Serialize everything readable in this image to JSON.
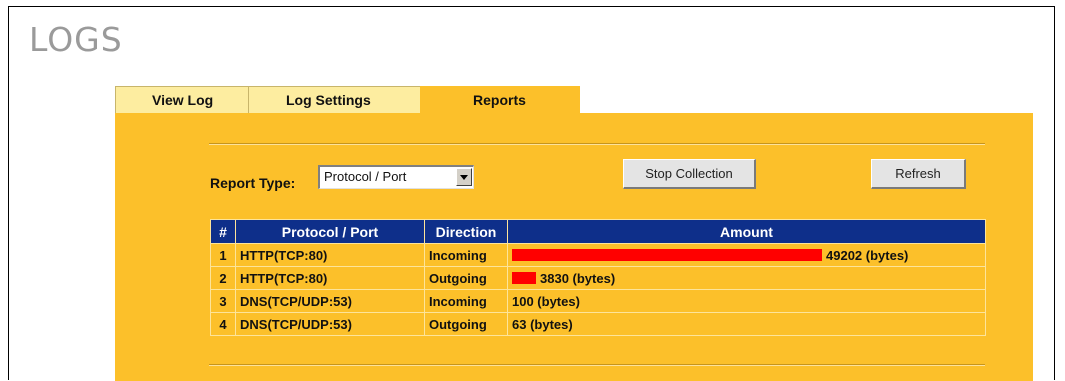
{
  "page": {
    "title": "LOGS"
  },
  "tabs": [
    {
      "label": "View Log",
      "active": false
    },
    {
      "label": "Log Settings",
      "active": false
    },
    {
      "label": "Reports",
      "active": true
    }
  ],
  "report": {
    "type_label": "Report Type:",
    "type_value": "Protocol / Port",
    "stop_button": "Stop Collection",
    "refresh_button": "Refresh"
  },
  "table": {
    "headers": [
      "#",
      "Protocol / Port",
      "Direction",
      "Amount"
    ],
    "rows": [
      {
        "num": "1",
        "protocol": "HTTP(TCP:80)",
        "direction": "Incoming",
        "amount": "49202 (bytes)",
        "bytes": 49202
      },
      {
        "num": "2",
        "protocol": "HTTP(TCP:80)",
        "direction": "Outgoing",
        "amount": "3830 (bytes)",
        "bytes": 3830
      },
      {
        "num": "3",
        "protocol": "DNS(TCP/UDP:53)",
        "direction": "Incoming",
        "amount": "100 (bytes)",
        "bytes": 100
      },
      {
        "num": "4",
        "protocol": "DNS(TCP/UDP:53)",
        "direction": "Outgoing",
        "amount": "63 (bytes)",
        "bytes": 63
      }
    ]
  },
  "colors": {
    "panel": "#fcc02a",
    "header": "#0e2f8a",
    "bar": "#ff0000"
  }
}
